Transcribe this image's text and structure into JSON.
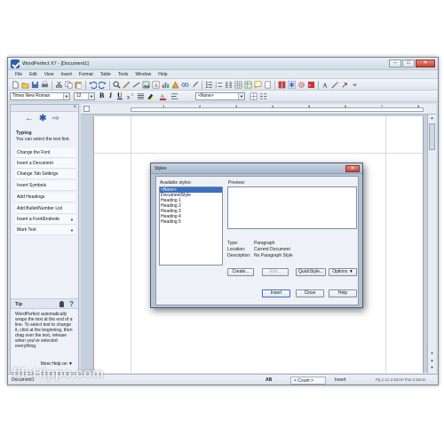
{
  "window": {
    "title": "WordPerfect X7 - [Document1]"
  },
  "menu": [
    "File",
    "Edit",
    "View",
    "Insert",
    "Format",
    "Table",
    "Tools",
    "Window",
    "Help"
  ],
  "format_bar": {
    "font": "Times New Roman",
    "size": "12",
    "style": "<None>",
    "bold": "B",
    "italic": "I",
    "underline": "U"
  },
  "sidebar": {
    "section_title": "Typing",
    "description": "You can select the text first.",
    "items": [
      "Change the Font",
      "Insert a Document",
      "Change Tab Settings",
      "Insert Symbols",
      "Add Headings",
      "Add Bullet/Number List",
      "Insert a Foot/Endnote",
      "Mark Text"
    ],
    "tip_label": "Tip",
    "tip_text": "WordPerfect automatically wraps the text at the end of a line. To select text to change it, click at the beginning, then drag over the text, release when you've selected everything.",
    "more_help": "More Help on"
  },
  "ruler": {
    "numbers": [
      "1",
      "2",
      "3",
      "4",
      "5",
      "6",
      "7",
      "8"
    ]
  },
  "dialog": {
    "title": "Styles",
    "available_label": "Available styles:",
    "preview_label": "Preview:",
    "styles": [
      "<None>",
      "DocumentStyle",
      "Heading 1",
      "Heading 2",
      "Heading 3",
      "Heading 4",
      "Heading 5"
    ],
    "type_label": "Type:",
    "type_value": "Paragraph",
    "location_label": "Location:",
    "location_value": "Current Document",
    "description_label": "Description:",
    "description_value": "No Paragraph Style",
    "buttons": {
      "create": "Create...",
      "edit": "Edit...",
      "quickstyle": "QuickStyle...",
      "options": "Options",
      "insert": "Insert",
      "close": "Close",
      "help": "Help"
    }
  },
  "statusbar": {
    "doc_name": "Document1",
    "ab": "AB",
    "count": "< Count >",
    "mode": "Insert",
    "position": "Pg 1 Ln 2.54cm Pos 2.54cm"
  },
  "watermark": "fileHippo.com"
}
